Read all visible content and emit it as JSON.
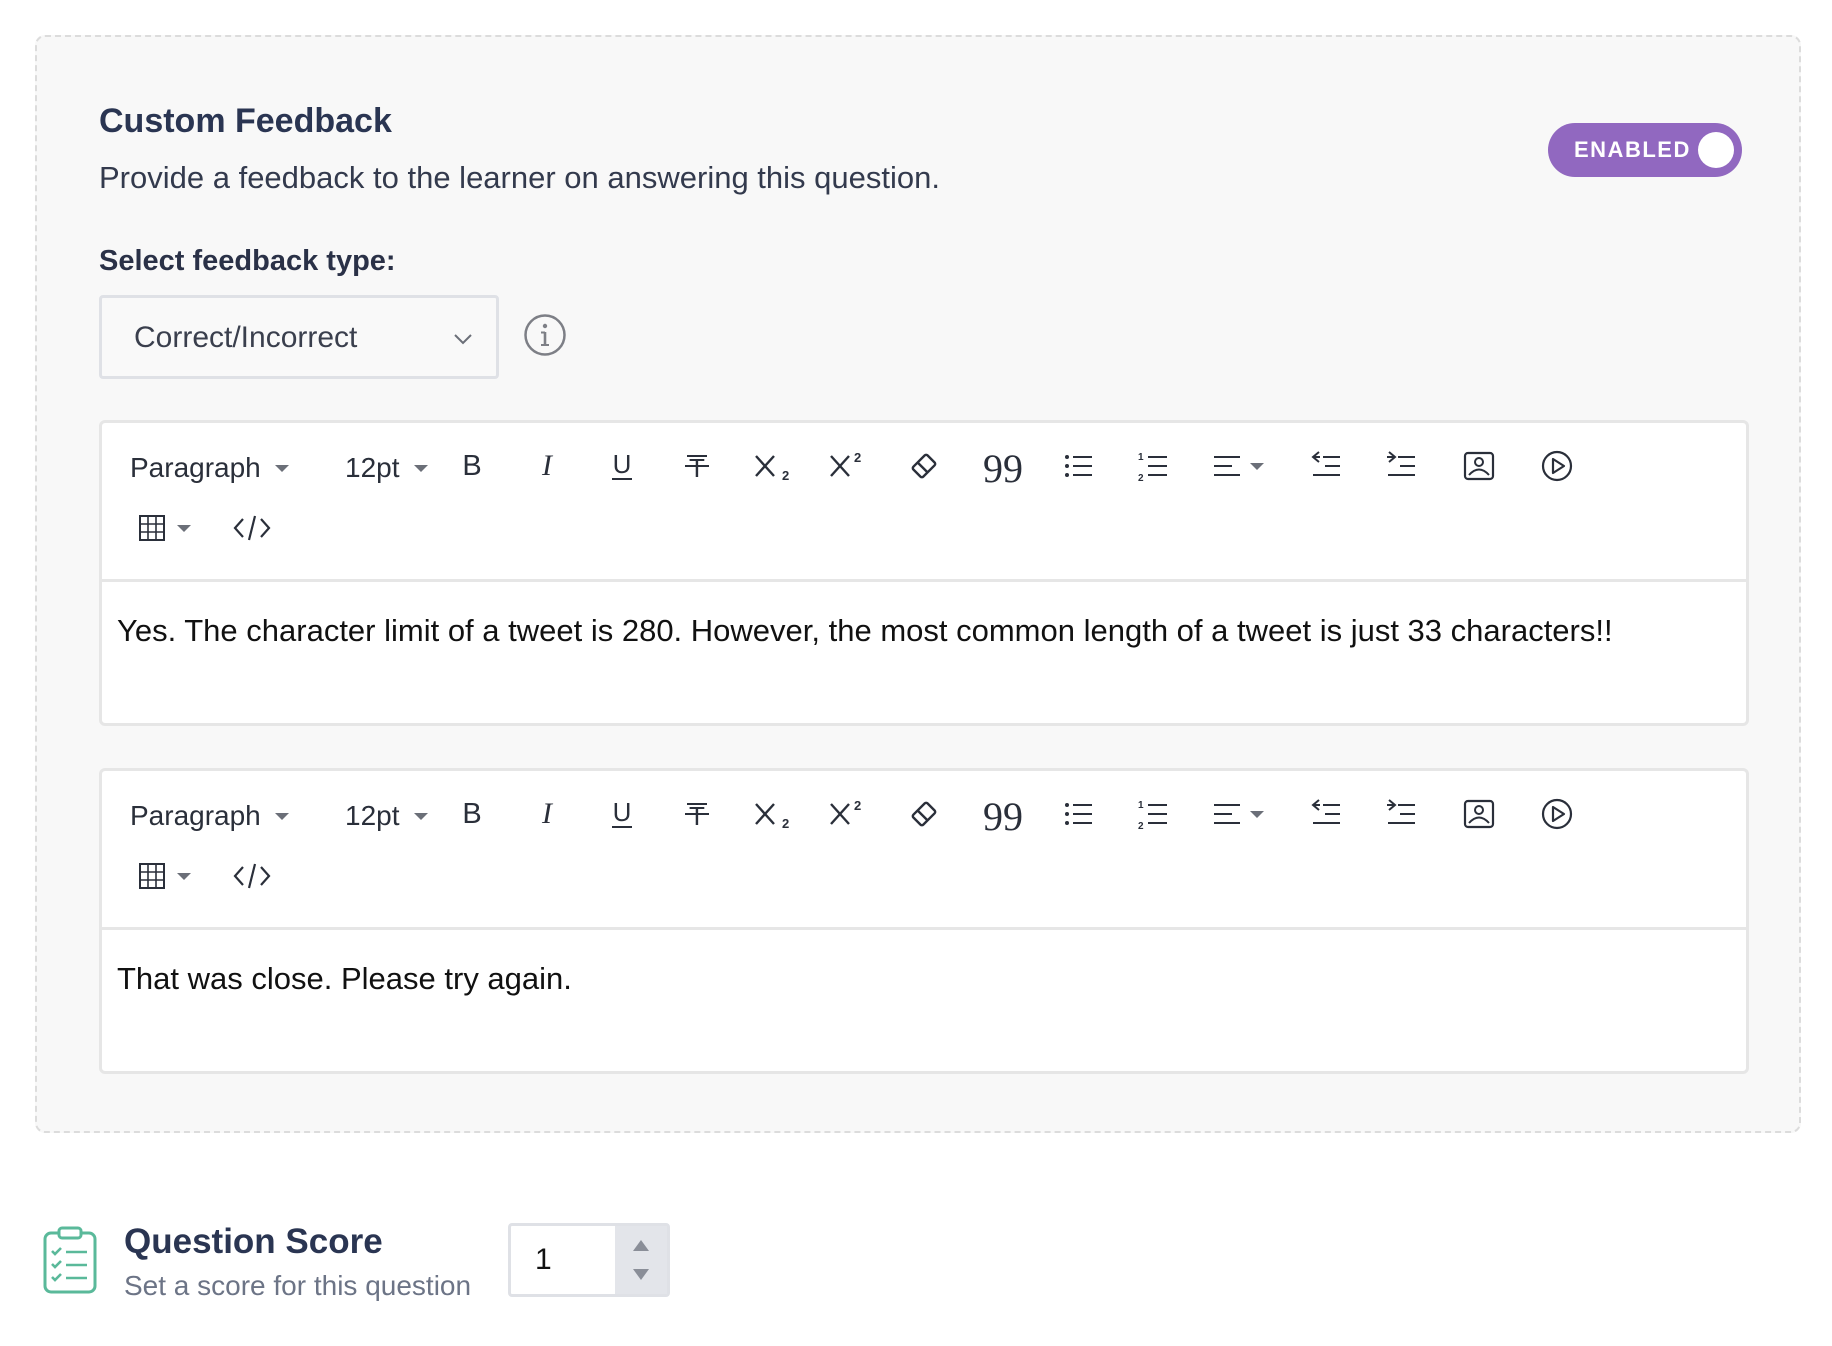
{
  "feedback": {
    "title": "Custom Feedback",
    "subtitle": "Provide a feedback to the learner on answering this question.",
    "toggle": {
      "label": "ENABLED",
      "on": true,
      "color": "#9168c0"
    },
    "select_label": "Select feedback type:",
    "select_value": "Correct/Incorrect",
    "info_icon": "info-icon"
  },
  "editors": [
    {
      "block_format": "Paragraph",
      "font_size": "12pt",
      "content": "Yes. The character limit of a tweet is 280. However, the most common length of a tweet is just 33 characters!!"
    },
    {
      "block_format": "Paragraph",
      "font_size": "12pt",
      "content": "That was close. Please try again."
    }
  ],
  "toolbar_icons": [
    "bold-icon",
    "italic-icon",
    "underline-icon",
    "strikethrough-icon",
    "subscript-icon",
    "superscript-icon",
    "clear-format-icon",
    "blockquote-icon",
    "bullet-list-icon",
    "numbered-list-icon",
    "align-icon",
    "outdent-icon",
    "indent-icon",
    "image-icon",
    "media-icon",
    "table-icon",
    "code-icon"
  ],
  "score": {
    "title": "Question Score",
    "subtitle": "Set a score for this question",
    "value": "1",
    "icon": "clipboard-checklist-icon",
    "icon_color": "#5ab99a"
  }
}
